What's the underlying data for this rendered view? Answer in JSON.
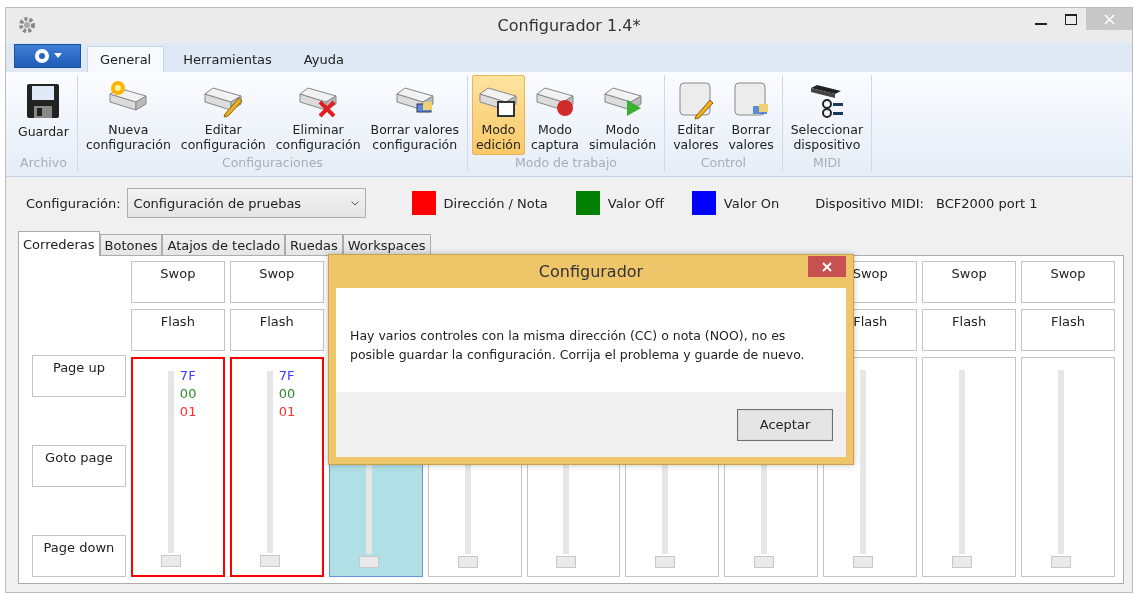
{
  "window": {
    "title": "Configurador 1.4*"
  },
  "ribbon": {
    "tabs": [
      {
        "label": "General",
        "selected": true
      },
      {
        "label": "Herramientas",
        "selected": false
      },
      {
        "label": "Ayuda",
        "selected": false
      }
    ],
    "groups": [
      {
        "label": "Archivo",
        "buttons": [
          {
            "lines": [
              "Guardar"
            ],
            "selected": false
          }
        ]
      },
      {
        "label": "Configuraciones",
        "buttons": [
          {
            "lines": [
              "Nueva",
              "configuración"
            ],
            "selected": false
          },
          {
            "lines": [
              "Editar",
              "configuración"
            ],
            "selected": false
          },
          {
            "lines": [
              "Eliminar",
              "configuración"
            ],
            "selected": false
          },
          {
            "lines": [
              "Borrar valores",
              "configuración"
            ],
            "selected": false
          }
        ]
      },
      {
        "label": "Modo de trabajo",
        "buttons": [
          {
            "lines": [
              "Modo",
              "edición"
            ],
            "selected": true
          },
          {
            "lines": [
              "Modo",
              "captura"
            ],
            "selected": false
          },
          {
            "lines": [
              "Modo",
              "simulación"
            ],
            "selected": false
          }
        ]
      },
      {
        "label": "Control",
        "buttons": [
          {
            "lines": [
              "Editar",
              "valores"
            ],
            "selected": false
          },
          {
            "lines": [
              "Borrar",
              "valores"
            ],
            "selected": false
          }
        ]
      },
      {
        "label": "MIDI",
        "buttons": [
          {
            "lines": [
              "Seleccionar",
              "dispositivo"
            ],
            "selected": false
          }
        ]
      }
    ]
  },
  "config_bar": {
    "label": "Configuración:",
    "value": "Configuración de pruebas",
    "legend": [
      {
        "label": "Dirección / Nota",
        "color": "#ff0000"
      },
      {
        "label": "Valor Off",
        "color": "#008000"
      },
      {
        "label": "Valor On",
        "color": "#0000ff"
      }
    ],
    "device_label": "Dispositivo MIDI:",
    "device": "BCF2000 port 1"
  },
  "tabs": [
    {
      "label": "Correderas",
      "selected": true
    },
    {
      "label": "Botones",
      "selected": false
    },
    {
      "label": "Atajos de teclado",
      "selected": false
    },
    {
      "label": "Ruedas",
      "selected": false
    },
    {
      "label": "Workspaces",
      "selected": false
    }
  ],
  "side_buttons": [
    "Page up",
    "Goto page",
    "Page down"
  ],
  "columns": [
    {
      "swop": "Swop",
      "flash": "Flash",
      "values": [
        {
          "text": "7F",
          "color": "#3b3bff"
        },
        {
          "text": "00",
          "color": "#2a8a2a"
        },
        {
          "text": "01",
          "color": "#ff3030"
        }
      ],
      "error": true,
      "selected": false,
      "level": 0
    },
    {
      "swop": "Swop",
      "flash": "Flash",
      "values": [
        {
          "text": "7F",
          "color": "#3b3bff"
        },
        {
          "text": "00",
          "color": "#2a8a2a"
        },
        {
          "text": "01",
          "color": "#ff3030"
        }
      ],
      "error": true,
      "selected": false,
      "level": 0
    },
    {
      "error": false,
      "selected": true,
      "level": 0
    },
    {
      "error": false,
      "selected": false,
      "level": 0
    },
    {
      "error": false,
      "selected": false,
      "level": 0
    },
    {
      "error": false,
      "selected": false,
      "level": 0
    },
    {
      "error": false,
      "selected": false,
      "level": 0
    },
    {
      "swop": "Swop",
      "flash": "Flash",
      "error": false,
      "selected": false,
      "level": 0
    },
    {
      "swop": "Swop",
      "flash": "Flash",
      "error": false,
      "selected": false,
      "level": 0
    },
    {
      "swop": "Swop",
      "flash": "Flash",
      "error": false,
      "selected": false,
      "level": 0
    }
  ],
  "dialog": {
    "title": "Configurador",
    "message": "Hay varios controles con la misma dirección (CC) o nota (NOO), no es posible guardar la configuración. Corrija el problema y guarde de nuevo.",
    "button": "Aceptar"
  }
}
